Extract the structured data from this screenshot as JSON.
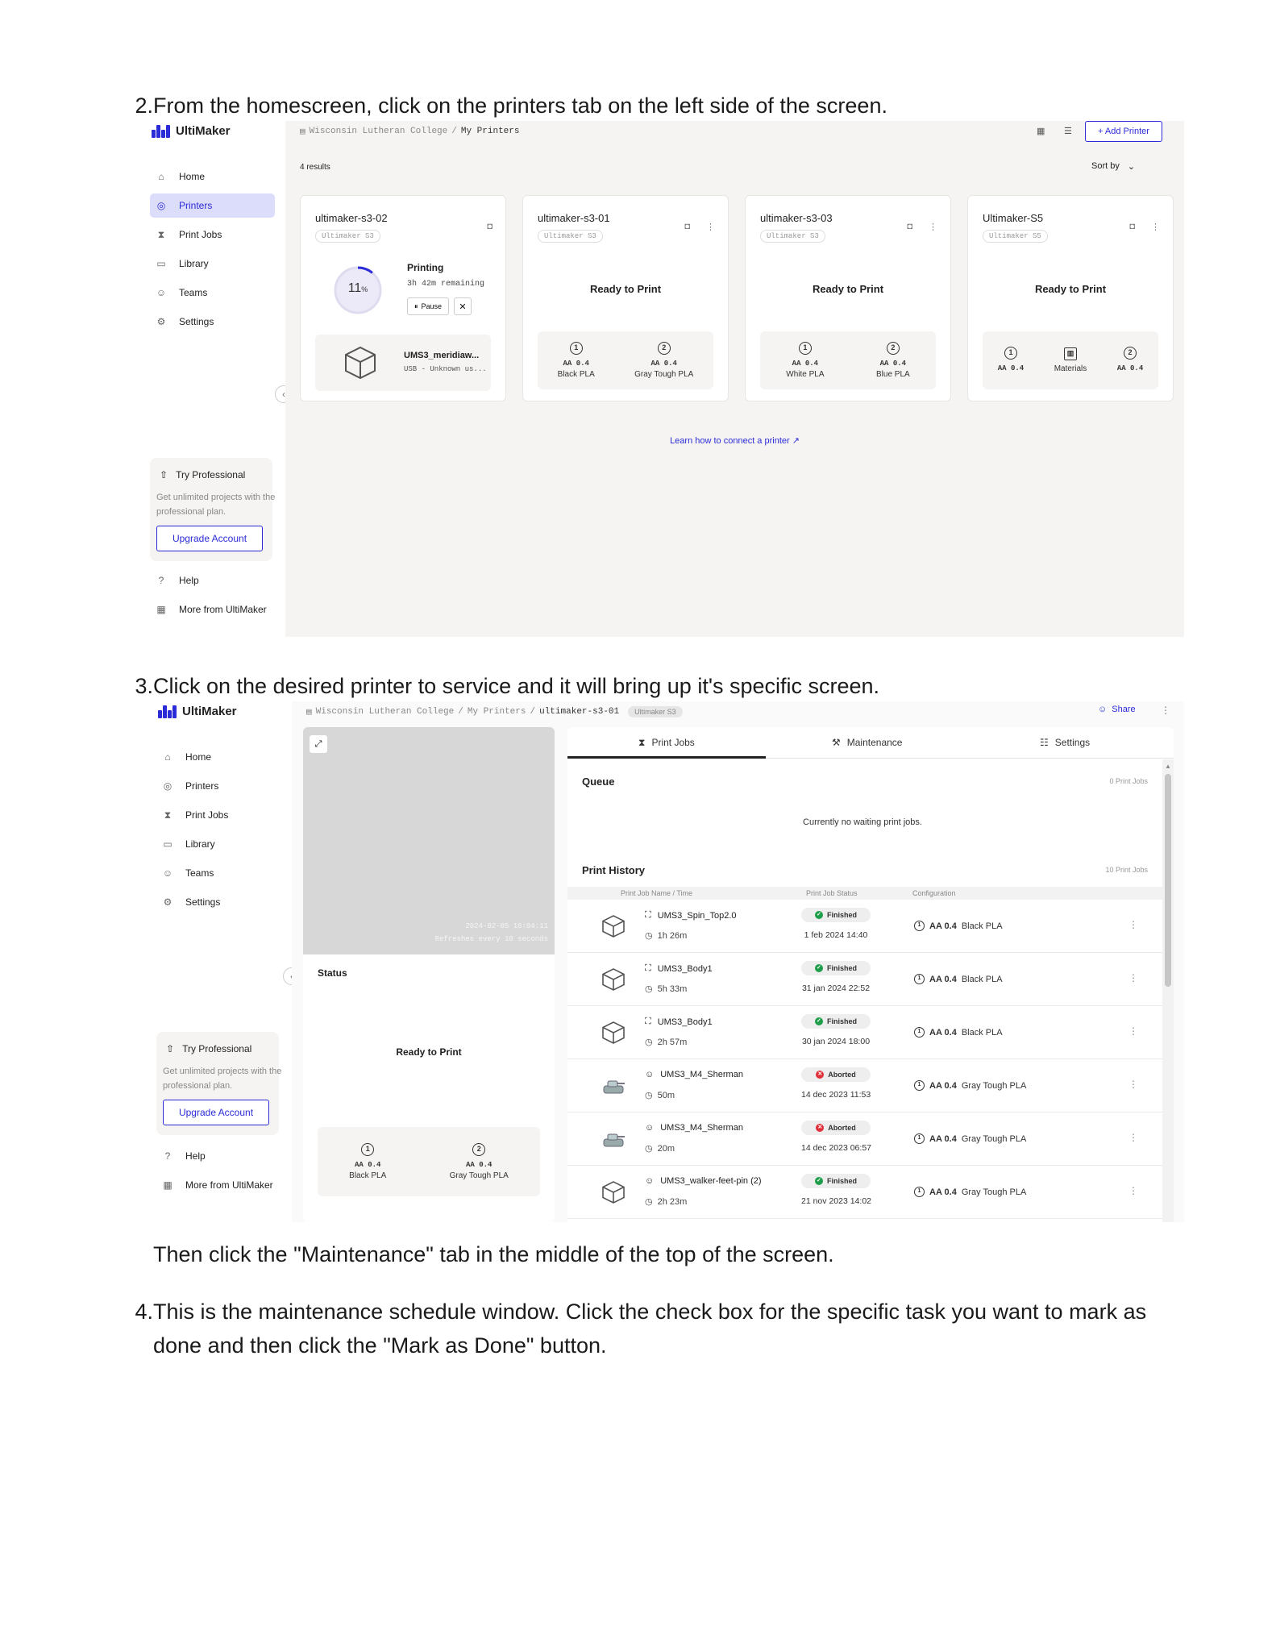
{
  "steps": {
    "s2_num": "2.",
    "s2_text": "From the homescreen, click on the printers tab on the left side of the screen.",
    "s3_num": "3.",
    "s3_text": "Click on the desired printer to service and it will bring up it's specific screen.",
    "s3_after": "Then click the \"Maintenance\" tab in the middle of the top of the screen.",
    "s4_num": "4.",
    "s4_text_line1": "This is the maintenance schedule window. Click the check box for the specific task you want to mark as",
    "s4_text_line2": "done and then click the \"Mark as Done\" button."
  },
  "app": {
    "brand": "UltiMaker",
    "accent": "#2b2bd8",
    "nav": [
      "Home",
      "Printers",
      "Print Jobs",
      "Library",
      "Teams",
      "Settings"
    ],
    "promo_title": "Try Professional",
    "promo_desc": "Get unlimited projects with the professional plan.",
    "upgrade": "Upgrade Account",
    "help": "Help",
    "more": "More from UltiMaker"
  },
  "shot1": {
    "crumb_org": "Wisconsin Lutheran College",
    "crumb_sep": "/",
    "crumb_page": "My Printers",
    "add_printer": "+ Add Printer",
    "results": "4 results",
    "sort": "Sort by",
    "learn": "Learn how to connect a printer",
    "card1": {
      "name": "ultimaker-s3-02",
      "model": "Ultimaker S3",
      "status": "Printing",
      "remaining": "3h 42m remaining",
      "progress_label": "11",
      "progress_unit": "%",
      "progress": 0.11,
      "pause": "Pause",
      "job": "UMS3_meridiaw...",
      "job_src": "USB - Unknown us..."
    },
    "card2": {
      "name": "ultimaker-s3-01",
      "model": "Ultimaker S3",
      "status": "Ready to Print",
      "m1_core": "AA 0.4",
      "m1_mat": "Black PLA",
      "m2_core": "AA 0.4",
      "m2_mat": "Gray Tough PLA"
    },
    "card3": {
      "name": "ultimaker-s3-03",
      "model": "Ultimaker S3",
      "status": "Ready to Print",
      "m1_core": "AA 0.4",
      "m1_mat": "White PLA",
      "m2_core": "AA 0.4",
      "m2_mat": "Blue PLA"
    },
    "card4": {
      "name": "Ultimaker-S5",
      "model": "Ultimaker S5",
      "status": "Ready to Print",
      "m1_core": "AA 0.4",
      "materials": "Materials",
      "m2_core": "AA 0.4"
    }
  },
  "shot2": {
    "crumb_org": "Wisconsin Lutheran College",
    "crumb_sep": "/",
    "crumb_page": "My Printers",
    "crumb_printer": "ultimaker-s3-01",
    "crumb_badge": "Ultimaker S3",
    "share": "Share",
    "cam_time": "2024-02-05 16:04:11",
    "cam_refresh": "Refreshes every 10 seconds",
    "status_title": "Status",
    "status": "Ready to Print",
    "m1_core": "AA 0.4",
    "m1_mat": "Black PLA",
    "m2_core": "AA 0.4",
    "m2_mat": "Gray Tough PLA",
    "tabs": [
      "Print Jobs",
      "Maintenance",
      "Settings"
    ],
    "queue_title": "Queue",
    "queue_count": "0 Print Jobs",
    "queue_empty": "Currently no waiting print jobs.",
    "history_title": "Print History",
    "history_count": "10 Print Jobs",
    "col_name": "Print Job Name / Time",
    "col_status": "Print Job Status",
    "col_config": "Configuration",
    "rows": [
      {
        "name": "UMS3_Spin_Top2.0",
        "time": "1h 26m",
        "status": "Finished",
        "date": "1 feb 2024 14:40",
        "core": "AA 0.4",
        "mat": "Black PLA"
      },
      {
        "name": "UMS3_Body1",
        "time": "5h 33m",
        "status": "Finished",
        "date": "31 jan 2024 22:52",
        "core": "AA 0.4",
        "mat": "Black PLA"
      },
      {
        "name": "UMS3_Body1",
        "time": "2h 57m",
        "status": "Finished",
        "date": "30 jan 2024 18:00",
        "core": "AA 0.4",
        "mat": "Black PLA"
      },
      {
        "name": "UMS3_M4_Sherman",
        "time": "50m",
        "status": "Aborted",
        "date": "14 dec 2023 11:53",
        "core": "AA 0.4",
        "mat": "Gray Tough PLA"
      },
      {
        "name": "UMS3_M4_Sherman",
        "time": "20m",
        "status": "Aborted",
        "date": "14 dec 2023 06:57",
        "core": "AA 0.4",
        "mat": "Gray Tough PLA"
      },
      {
        "name": "UMS3_walker-feet-pin (2)",
        "time": "2h 23m",
        "status": "Finished",
        "date": "21 nov 2023 14:02",
        "core": "AA 0.4",
        "mat": "Gray Tough PLA"
      }
    ],
    "colors": {
      "finished": "#1e9e4a",
      "aborted": "#e0303a"
    }
  }
}
